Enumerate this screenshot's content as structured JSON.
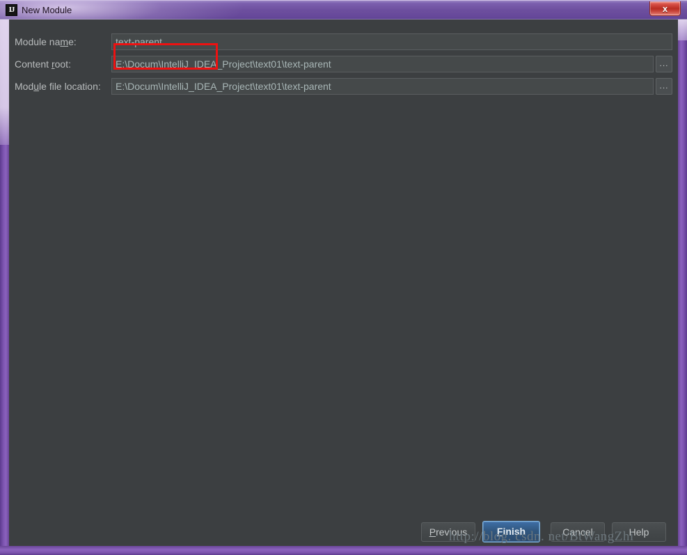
{
  "window": {
    "title": "New Module",
    "icon": "IJ",
    "icon_name": "intellij-idea-icon",
    "close_label": "x",
    "accent_border_color": "#7b53ae",
    "titlebar_gradient_from": "#9a85c4",
    "titlebar_gradient_to": "#5b4090",
    "background_color": "#3c3f41",
    "close_button_color": "#b92c22"
  },
  "form": {
    "fields": [
      {
        "label_prefix": "Module na",
        "label_mnemonic": "m",
        "label_suffix": "e:",
        "label_full": "Module name:",
        "value": "text-parent",
        "has_browse": false,
        "highlighted": true
      },
      {
        "label_prefix": "Content ",
        "label_mnemonic": "r",
        "label_suffix": "oot:",
        "label_full": "Content root:",
        "value": "E:\\Docum\\IntelliJ_IDEA_Project\\text01\\text-parent",
        "has_browse": true,
        "highlighted": false
      },
      {
        "label_prefix": "Mod",
        "label_mnemonic": "u",
        "label_suffix": "le file location:",
        "label_full": "Module file location:",
        "value": "E:\\Docum\\IntelliJ_IDEA_Project\\text01\\text-parent",
        "has_browse": true,
        "highlighted": false
      }
    ],
    "browse_label": "...",
    "annotation_color": "#ee1111"
  },
  "buttons": [
    {
      "prefix": "",
      "mnemonic": "P",
      "suffix": "revious",
      "label": "Previous",
      "default": false
    },
    {
      "prefix": "",
      "mnemonic": "F",
      "suffix": "inish",
      "label": "Finish",
      "default": true
    },
    {
      "prefix": "C",
      "mnemonic": "",
      "suffix": "ancel",
      "label": "Cancel",
      "default": false
    },
    {
      "prefix": "H",
      "mnemonic": "",
      "suffix": "elp",
      "label": "Help",
      "default": false
    }
  ],
  "watermark": {
    "text": "http://blog. csdn. net/BtWangZhi"
  }
}
